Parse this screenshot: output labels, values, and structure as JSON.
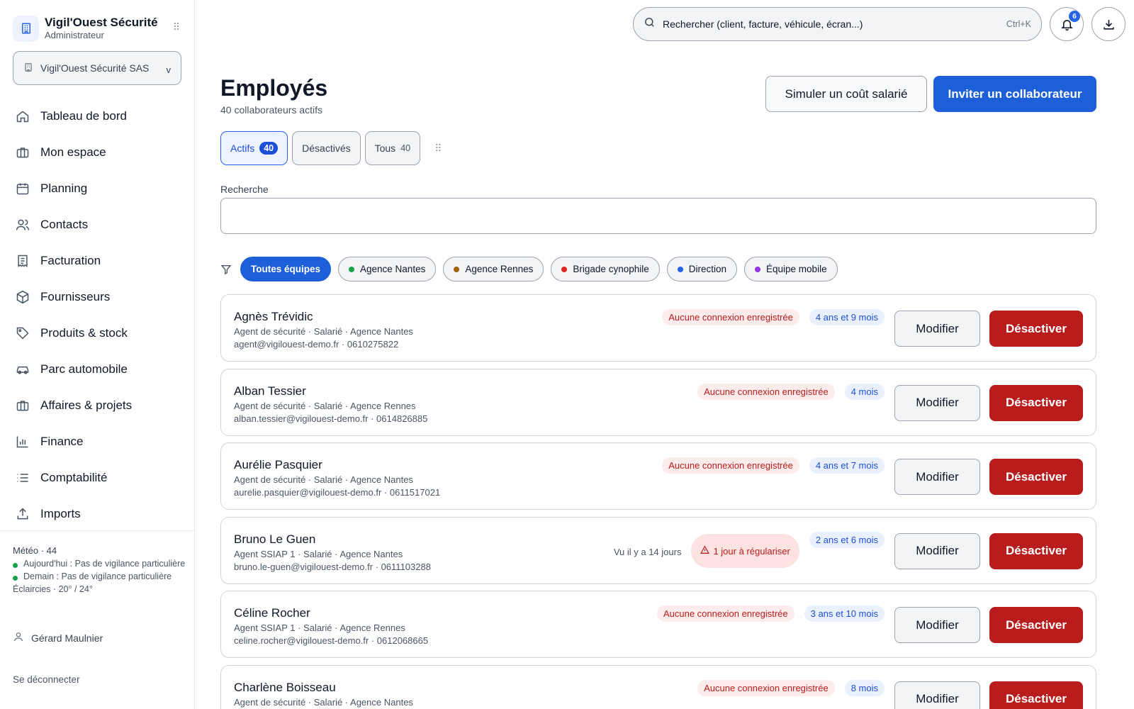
{
  "brand": {
    "name": "Vigil'Ouest Sécurité",
    "role": "Administrateur",
    "logo_icon": "building-icon"
  },
  "company_select": {
    "value": "Vigil'Ouest Sécurité SAS",
    "chevron": "v"
  },
  "nav": [
    {
      "label": "Tableau de bord",
      "icon": "home-icon"
    },
    {
      "label": "Mon espace",
      "icon": "briefcase-icon"
    },
    {
      "label": "Planning",
      "icon": "calendar-icon"
    },
    {
      "label": "Contacts",
      "icon": "users-icon"
    },
    {
      "label": "Facturation",
      "icon": "receipt-icon"
    },
    {
      "label": "Fournisseurs",
      "icon": "box-icon"
    },
    {
      "label": "Produits & stock",
      "icon": "tag-icon"
    },
    {
      "label": "Parc automobile",
      "icon": "car-icon"
    },
    {
      "label": "Affaires & projets",
      "icon": "briefcase-icon"
    },
    {
      "label": "Finance",
      "icon": "bar-chart-icon"
    },
    {
      "label": "Comptabilité",
      "icon": "list-icon"
    },
    {
      "label": "Imports",
      "icon": "upload-icon"
    }
  ],
  "weather": {
    "title": "Météo · 44",
    "today": "Aujourd'hui : Pas de vigilance particulière",
    "tomorrow": "Demain : Pas de vigilance particulière",
    "forecast": "Éclaircies · 20° / 24°"
  },
  "user": {
    "name": "Gérard Maulnier"
  },
  "logout_label": "Se déconnecter",
  "topbar": {
    "search_placeholder": "Rechercher (client, facture, véhicule, écran...)",
    "shortcut": "Ctrl+K",
    "notifications_count": "6"
  },
  "page": {
    "title": "Employés",
    "subtitle": "40 collaborateurs actifs",
    "simulate_button": "Simuler un coût salarié",
    "invite_button": "Inviter un collaborateur"
  },
  "tabs": [
    {
      "label": "Actifs",
      "count": "40",
      "active": true
    },
    {
      "label": "Désactivés",
      "count": "",
      "active": false
    },
    {
      "label": "Tous",
      "count": "40",
      "active": false
    }
  ],
  "search": {
    "label": "Recherche",
    "value": "",
    "placeholder": ""
  },
  "filters": [
    {
      "label": "Toutes équipes",
      "active": true,
      "color": ""
    },
    {
      "label": "Agence Nantes",
      "active": false,
      "color": "#16a34a"
    },
    {
      "label": "Agence Rennes",
      "active": false,
      "color": "#a16207"
    },
    {
      "label": "Brigade cynophile",
      "active": false,
      "color": "#dc2626"
    },
    {
      "label": "Direction",
      "active": false,
      "color": "#2563eb"
    },
    {
      "label": "Équipe mobile",
      "active": false,
      "color": "#9333ea"
    }
  ],
  "employees": [
    {
      "name": "Agnès Trévidic",
      "meta": "Agent de sécurité · Salarié · Agence Nantes",
      "contact": "agent@vigilouest-demo.fr · 0610275822",
      "status": "Aucune connexion enregistrée",
      "seen": "",
      "alert": "",
      "tenure": "4 ans et 9 mois"
    },
    {
      "name": "Alban Tessier",
      "meta": "Agent de sécurité · Salarié · Agence Rennes",
      "contact": "alban.tessier@vigilouest-demo.fr · 0614826885",
      "status": "Aucune connexion enregistrée",
      "seen": "",
      "alert": "",
      "tenure": "4 mois"
    },
    {
      "name": "Aurélie Pasquier",
      "meta": "Agent de sécurité · Salarié · Agence Nantes",
      "contact": "aurelie.pasquier@vigilouest-demo.fr · 0611517021",
      "status": "Aucune connexion enregistrée",
      "seen": "",
      "alert": "",
      "tenure": "4 ans et 7 mois"
    },
    {
      "name": "Bruno Le Guen",
      "meta": "Agent SSIAP 1 · Salarié · Agence Nantes",
      "contact": "bruno.le-guen@vigilouest-demo.fr · 0611103288",
      "status": "",
      "seen": "Vu il y a 14 jours",
      "alert": "1 jour à régulariser",
      "tenure": "2 ans et 6 mois"
    },
    {
      "name": "Céline Rocher",
      "meta": "Agent SSIAP 1 · Salarié · Agence Rennes",
      "contact": "celine.rocher@vigilouest-demo.fr · 0612068665",
      "status": "Aucune connexion enregistrée",
      "seen": "",
      "alert": "",
      "tenure": "3 ans et 10 mois"
    },
    {
      "name": "Charlène Boisseau",
      "meta": "Agent de sécurité · Salarié · Agence Nantes",
      "contact": "",
      "status": "Aucune connexion enregistrée",
      "seen": "",
      "alert": "",
      "tenure": "8 mois"
    }
  ],
  "row_actions": {
    "edit": "Modifier",
    "deactivate": "Désactiver"
  },
  "colors": {
    "accent": "#1d5fd8",
    "danger": "#b91c1c"
  }
}
